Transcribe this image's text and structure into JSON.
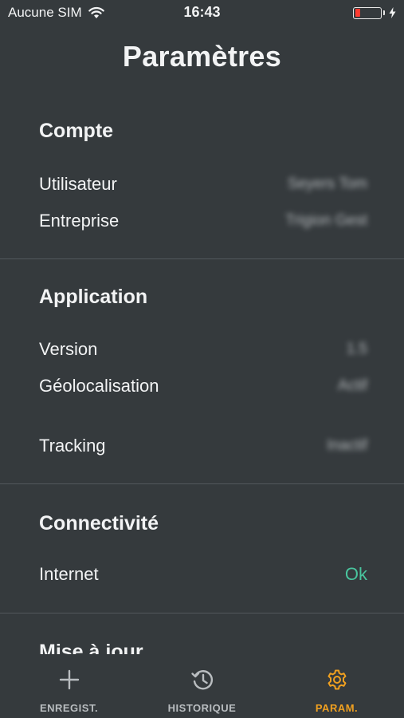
{
  "status_bar": {
    "carrier": "Aucune SIM",
    "time": "16:43",
    "battery_level": 0.2,
    "battery_color": "#ff3b30"
  },
  "header": {
    "title": "Paramètres"
  },
  "sections": {
    "account": {
      "title": "Compte",
      "rows": [
        {
          "label": "Utilisateur",
          "value": "Seyers Tom"
        },
        {
          "label": "Entreprise",
          "value": "Trigion Gest"
        }
      ]
    },
    "application": {
      "title": "Application",
      "rows": [
        {
          "label": "Version",
          "value": "1.5"
        },
        {
          "label": "Géolocalisation",
          "value": "Actif"
        },
        {
          "label": "Tracking",
          "value": "Inactif"
        }
      ]
    },
    "connectivity": {
      "title": "Connectivité",
      "rows": [
        {
          "label": "Internet",
          "value": "Ok"
        }
      ]
    },
    "update": {
      "title": "Mise à jour"
    }
  },
  "tab_bar": {
    "tabs": [
      {
        "label": "ENREGIST.",
        "icon": "plus-icon"
      },
      {
        "label": "HISTORIQUE",
        "icon": "history-icon"
      },
      {
        "label": "PARAM.",
        "icon": "gear-icon"
      }
    ],
    "active_index": 2
  },
  "colors": {
    "background": "#353a3d",
    "accent": "#f0a020",
    "ok_status": "#49c59e",
    "divider": "#52585c"
  }
}
